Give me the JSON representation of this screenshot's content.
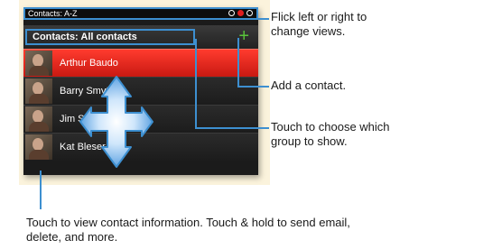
{
  "status_bar": {
    "title": "Contacts: A-Z"
  },
  "group_bar": {
    "selector_label": "Contacts: All contacts",
    "add_icon": "+"
  },
  "contacts": [
    {
      "name": "Arthur Baudo",
      "selected": true
    },
    {
      "name": "Barry Smyth"
    },
    {
      "name": "Jim Som"
    },
    {
      "name": "Kat Bleser"
    }
  ],
  "callouts": {
    "flick": "Flick left or right to change views.",
    "add": "Add a contact.",
    "group": "Touch to choose which group to show.",
    "view": "Touch to view contact information. Touch & hold to send email, delete, and more."
  },
  "colors": {
    "accent": "#3d8fd0",
    "selected": "#e8261c",
    "add_plus": "#59c43a"
  }
}
